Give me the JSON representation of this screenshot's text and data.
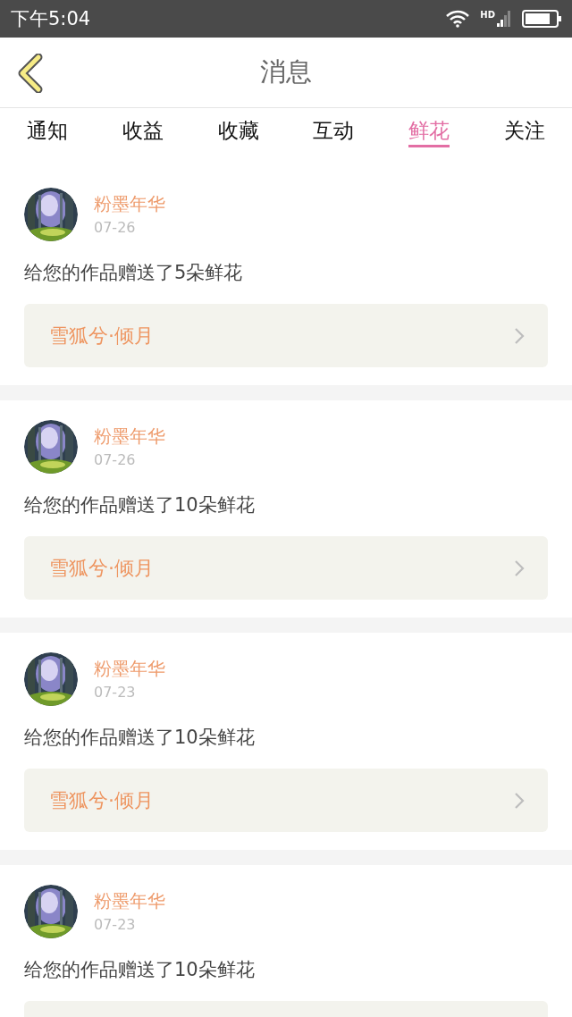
{
  "status_bar": {
    "time": "下午5:04",
    "network_label": "HD"
  },
  "header": {
    "title": "消息"
  },
  "tabs": [
    {
      "label": "通知",
      "selected": false
    },
    {
      "label": "收益",
      "selected": false
    },
    {
      "label": "收藏",
      "selected": false
    },
    {
      "label": "互动",
      "selected": false
    },
    {
      "label": "鲜花",
      "selected": true
    },
    {
      "label": "关注",
      "selected": false
    }
  ],
  "messages": [
    {
      "sender": "粉墨年华",
      "date": "07-26",
      "text": "给您的作品赠送了5朵鲜花",
      "work": "雪狐兮·倾月"
    },
    {
      "sender": "粉墨年华",
      "date": "07-26",
      "text": "给您的作品赠送了10朵鲜花",
      "work": "雪狐兮·倾月"
    },
    {
      "sender": "粉墨年华",
      "date": "07-23",
      "text": "给您的作品赠送了10朵鲜花",
      "work": "雪狐兮·倾月"
    },
    {
      "sender": "粉墨年华",
      "date": "07-23",
      "text": "给您的作品赠送了10朵鲜花"
    }
  ]
}
